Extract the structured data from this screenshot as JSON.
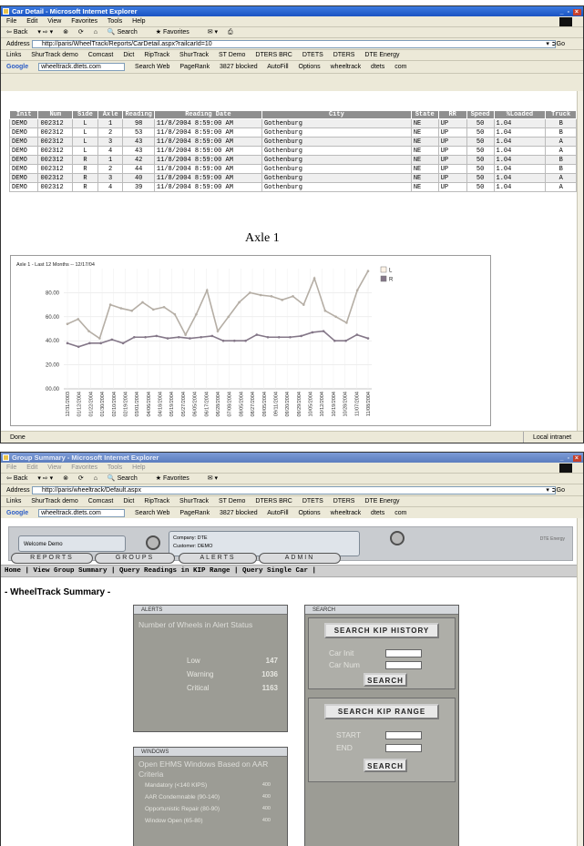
{
  "window1": {
    "title": "Car Detail - Microsoft Internet Explorer",
    "menu": [
      "File",
      "Edit",
      "View",
      "Favorites",
      "Tools",
      "Help"
    ],
    "toolbar": [
      "Back",
      "Search",
      "Favorites"
    ],
    "address_label": "Address",
    "address": "http://paris/WheelTrack/Reports/CarDetail.aspx?railcarId=10",
    "go": "Go",
    "links": [
      "Links",
      "ShurTrack demo",
      "Comcast",
      "Dict",
      "RipTrack",
      "ShurTrack",
      "ST Demo",
      "DTERS BRC",
      "DTETS",
      "DTERS",
      "DTE Energy"
    ],
    "google": {
      "label": "Google",
      "query": "wheeltrack.dtets.com",
      "search": "Search Web",
      "pagerank": "PageRank",
      "blocked": "3827 blocked",
      "autofill": "AutoFill",
      "options": "Options",
      "extras": [
        "wheeltrack",
        "dtets",
        "com"
      ]
    },
    "table": {
      "headers": [
        "Init",
        "Num",
        "Side",
        "Axle",
        "Reading",
        "Reading Date",
        "City",
        "State",
        "RR",
        "Speed",
        "%Loaded",
        "Truck"
      ],
      "rows": [
        [
          "DEMO",
          "002312",
          "L",
          "1",
          "98",
          "11/8/2004 8:59:00 AM",
          "Gothenburg",
          "NE",
          "UP",
          "50",
          "1.04",
          "B"
        ],
        [
          "DEMO",
          "002312",
          "L",
          "2",
          "53",
          "11/8/2004 8:59:00 AM",
          "Gothenburg",
          "NE",
          "UP",
          "50",
          "1.04",
          "B"
        ],
        [
          "DEMO",
          "002312",
          "L",
          "3",
          "43",
          "11/8/2004 8:59:00 AM",
          "Gothenburg",
          "NE",
          "UP",
          "50",
          "1.04",
          "A"
        ],
        [
          "DEMO",
          "002312",
          "L",
          "4",
          "43",
          "11/8/2004 8:59:00 AM",
          "Gothenburg",
          "NE",
          "UP",
          "50",
          "1.04",
          "A"
        ],
        [
          "DEMO",
          "002312",
          "R",
          "1",
          "42",
          "11/8/2004 8:59:00 AM",
          "Gothenburg",
          "NE",
          "UP",
          "50",
          "1.04",
          "B"
        ],
        [
          "DEMO",
          "002312",
          "R",
          "2",
          "44",
          "11/8/2004 8:59:00 AM",
          "Gothenburg",
          "NE",
          "UP",
          "50",
          "1.04",
          "B"
        ],
        [
          "DEMO",
          "002312",
          "R",
          "3",
          "40",
          "11/8/2004 8:59:00 AM",
          "Gothenburg",
          "NE",
          "UP",
          "50",
          "1.04",
          "A"
        ],
        [
          "DEMO",
          "002312",
          "R",
          "4",
          "39",
          "11/8/2004 8:59:00 AM",
          "Gothenburg",
          "NE",
          "UP",
          "50",
          "1.04",
          "A"
        ]
      ]
    },
    "axle_title": "Axle 1",
    "status": "Done",
    "zone": "Local intranet"
  },
  "chart_data": {
    "type": "line",
    "title": "Axle 1 - Last 12 Months -- 12/17/04",
    "x": [
      "12/31/2003",
      "01/12/2004",
      "01/22/2004",
      "01/30/2004",
      "02/10/2004",
      "02/19/2004",
      "03/01/2004",
      "04/06/2004",
      "04/18/2004",
      "05/19/2004",
      "05/27/2004",
      "06/05/2004",
      "06/17/2004",
      "06/28/2004",
      "07/08/2004",
      "08/05/2004",
      "08/27/2004",
      "09/05/2004",
      "09/11/2004",
      "09/20/2004",
      "09/29/2004",
      "10/05/2004",
      "10/12/2004",
      "10/19/2004",
      "10/28/2004",
      "11/07/2004",
      "11/08/2004"
    ],
    "series": [
      {
        "name": "L",
        "color": "#b5aea5",
        "values": [
          54,
          58,
          48,
          42,
          70,
          67,
          65,
          72,
          66,
          68,
          62,
          45,
          62,
          82,
          48,
          60,
          72,
          80,
          78,
          77,
          74,
          77,
          70,
          92,
          65,
          60,
          55,
          82,
          98
        ]
      },
      {
        "name": "R",
        "color": "#847788",
        "values": [
          38,
          35,
          38,
          38,
          41,
          38,
          43,
          43,
          44,
          42,
          43,
          42,
          43,
          44,
          40,
          40,
          40,
          45,
          43,
          43,
          43,
          44,
          47,
          48,
          40,
          40,
          45,
          42
        ]
      }
    ],
    "yticks": [
      "00.00",
      "20.00",
      "40.00",
      "60.00",
      "80.00"
    ],
    "ylim": [
      0,
      100
    ],
    "legend": "top-right"
  },
  "window2": {
    "title": "Group Summary - Microsoft Internet Explorer",
    "menu": [
      "File",
      "Edit",
      "View",
      "Favorites",
      "Tools",
      "Help"
    ],
    "address": "http://paris/wheeltrack/Default.aspx",
    "welcome": "Welcome Demo",
    "company_line1": "Company: DTE",
    "company_line2": "Customer: DEMO",
    "brand": "DTE Energy",
    "nav": [
      "REPORTS",
      "GROUPS",
      "ALERTS",
      "ADMIN"
    ],
    "links_row": "Home | View Group Summary | Query Readings in KIP Range | Query Single Car |",
    "summary_title": "- WheelTrack Summary -",
    "alerts": {
      "header": "ALERTS",
      "heading": "Number of Wheels in Alert Status",
      "rows": [
        {
          "label": "Low",
          "value": "147"
        },
        {
          "label": "Warning",
          "value": "1036"
        },
        {
          "label": "Critical",
          "value": "1163"
        }
      ]
    },
    "windows": {
      "header": "WINDOWS",
      "heading": "Open EHMS Windows Based on AAR Criteria",
      "rows": [
        {
          "label": "Mandatory (<140 KIPS)",
          "value": "400"
        },
        {
          "label": "AAR Condemnable (90-140)",
          "value": "400"
        },
        {
          "label": "Opportunistic Repair (80-90)",
          "value": "400"
        },
        {
          "label": "Window Open (65-80)",
          "value": "400"
        }
      ]
    },
    "search": {
      "header": "SEARCH",
      "history_btn": "SEARCH KIP HISTORY",
      "car_init": "Car Init",
      "car_num": "Car Num",
      "search_btn": "SEARCH",
      "range_btn": "SEARCH KIP RANGE",
      "start": "START",
      "end": "END",
      "search_btn2": "SEARCH"
    }
  }
}
